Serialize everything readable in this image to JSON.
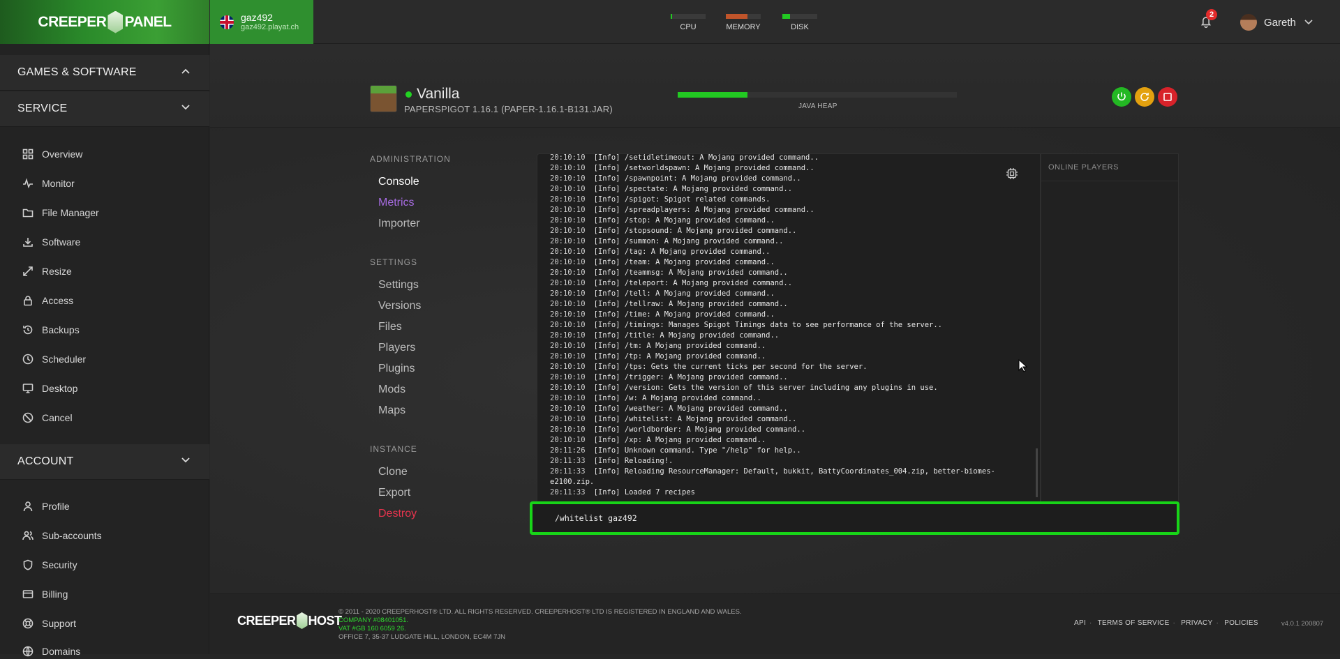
{
  "topbar": {
    "logo_left": "CREEPER",
    "logo_right": "PANEL",
    "server_name": "gaz492",
    "server_host": "gaz492.playat.ch",
    "meters": [
      {
        "label": "CPU",
        "fill": 0.04,
        "color": "#22c922"
      },
      {
        "label": "MEMORY",
        "fill": 0.62,
        "color": "#c0542a"
      },
      {
        "label": "DISK",
        "fill": 0.22,
        "color": "#22c922"
      }
    ],
    "notification_count": "2",
    "username": "Gareth"
  },
  "sidebar": {
    "sections": [
      {
        "label": "GAMES & SOFTWARE",
        "expanded": true
      },
      {
        "label": "SERVICE",
        "expanded": false
      },
      {
        "label": "ACCOUNT",
        "expanded": false
      }
    ],
    "service_items": [
      "Overview",
      "Monitor",
      "File Manager",
      "Software",
      "Resize",
      "Access",
      "Backups",
      "Scheduler",
      "Desktop",
      "Cancel"
    ],
    "account_items": [
      "Profile",
      "Sub-accounts",
      "Security",
      "Billing",
      "Support",
      "Domains"
    ]
  },
  "server": {
    "title": "Vanilla",
    "subtitle": "PAPERSPIGOT 1.16.1 (PAPER-1.16.1-B131.JAR)",
    "heap_label": "JAVA HEAP",
    "heap_fill": 0.25,
    "status_color": "#22d322"
  },
  "adminnav": {
    "administration": "ADMINISTRATION",
    "admin_items": [
      "Console",
      "Metrics",
      "Importer"
    ],
    "settings": "SETTINGS",
    "settings_items": [
      "Settings",
      "Versions",
      "Files",
      "Players",
      "Plugins",
      "Mods",
      "Maps"
    ],
    "instance": "INSTANCE",
    "instance_items": [
      "Clone",
      "Export",
      "Destroy"
    ],
    "active_color": "#a66be0",
    "danger_color": "#e8344e"
  },
  "console": {
    "lines": [
      {
        "ts": "20:10:10",
        "text": "[Info] /setidletimeout: A Mojang provided command.."
      },
      {
        "ts": "20:10:10",
        "text": "[Info] /setworldspawn: A Mojang provided command.."
      },
      {
        "ts": "20:10:10",
        "text": "[Info] /spawnpoint: A Mojang provided command.."
      },
      {
        "ts": "20:10:10",
        "text": "[Info] /spectate: A Mojang provided command.."
      },
      {
        "ts": "20:10:10",
        "text": "[Info] /spigot: Spigot related commands."
      },
      {
        "ts": "20:10:10",
        "text": "[Info] /spreadplayers: A Mojang provided command.."
      },
      {
        "ts": "20:10:10",
        "text": "[Info] /stop: A Mojang provided command.."
      },
      {
        "ts": "20:10:10",
        "text": "[Info] /stopsound: A Mojang provided command.."
      },
      {
        "ts": "20:10:10",
        "text": "[Info] /summon: A Mojang provided command.."
      },
      {
        "ts": "20:10:10",
        "text": "[Info] /tag: A Mojang provided command.."
      },
      {
        "ts": "20:10:10",
        "text": "[Info] /team: A Mojang provided command.."
      },
      {
        "ts": "20:10:10",
        "text": "[Info] /teammsg: A Mojang provided command.."
      },
      {
        "ts": "20:10:10",
        "text": "[Info] /teleport: A Mojang provided command.."
      },
      {
        "ts": "20:10:10",
        "text": "[Info] /tell: A Mojang provided command.."
      },
      {
        "ts": "20:10:10",
        "text": "[Info] /tellraw: A Mojang provided command.."
      },
      {
        "ts": "20:10:10",
        "text": "[Info] /time: A Mojang provided command.."
      },
      {
        "ts": "20:10:10",
        "text": "[Info] /timings: Manages Spigot Timings data to see performance of the server.."
      },
      {
        "ts": "20:10:10",
        "text": "[Info] /title: A Mojang provided command.."
      },
      {
        "ts": "20:10:10",
        "text": "[Info] /tm: A Mojang provided command.."
      },
      {
        "ts": "20:10:10",
        "text": "[Info] /tp: A Mojang provided command.."
      },
      {
        "ts": "20:10:10",
        "text": "[Info] /tps: Gets the current ticks per second for the server."
      },
      {
        "ts": "20:10:10",
        "text": "[Info] /trigger: A Mojang provided command.."
      },
      {
        "ts": "20:10:10",
        "text": "[Info] /version: Gets the version of this server including any plugins in use."
      },
      {
        "ts": "20:10:10",
        "text": "[Info] /w: A Mojang provided command.."
      },
      {
        "ts": "20:10:10",
        "text": "[Info] /weather: A Mojang provided command.."
      },
      {
        "ts": "20:10:10",
        "text": "[Info] /whitelist: A Mojang provided command.."
      },
      {
        "ts": "20:10:10",
        "text": "[Info] /worldborder: A Mojang provided command.."
      },
      {
        "ts": "20:10:10",
        "text": "[Info] /xp: A Mojang provided command.."
      },
      {
        "ts": "20:11:26",
        "text": "[Info] Unknown command. Type \"/help\" for help.."
      },
      {
        "ts": "20:11:33",
        "text": "[Info] Reloading!."
      },
      {
        "ts": "20:11:33",
        "text": "[Info] Reloading ResourceManager: Default, bukkit, BattyCoordinates_004.zip, better-biomes-"
      },
      {
        "ts": "",
        "text": "e2100.zip."
      },
      {
        "ts": "20:11:33",
        "text": "[Info] Loaded 7 recipes"
      }
    ],
    "command_value": "/whitelist gaz492",
    "online_players_label": "ONLINE PLAYERS"
  },
  "footer": {
    "logo_left": "CREEPER",
    "logo_right": "HOST",
    "copyright": "© 2011 - 2020 CREEPERHOST® LTD. ALL RIGHTS RESERVED. CREEPERHOST® LTD IS REGISTERED IN ENGLAND AND WALES.",
    "company": "COMPANY #08401051.",
    "vat": "VAT #GB 160 6059 26.",
    "office": "OFFICE 7, 35-37 LUDGATE HILL, LONDON, EC4M 7JN",
    "links": [
      "API",
      "TERMS OF SERVICE",
      "PRIVACY",
      "POLICIES"
    ],
    "version": "v4.0.1 200807"
  }
}
